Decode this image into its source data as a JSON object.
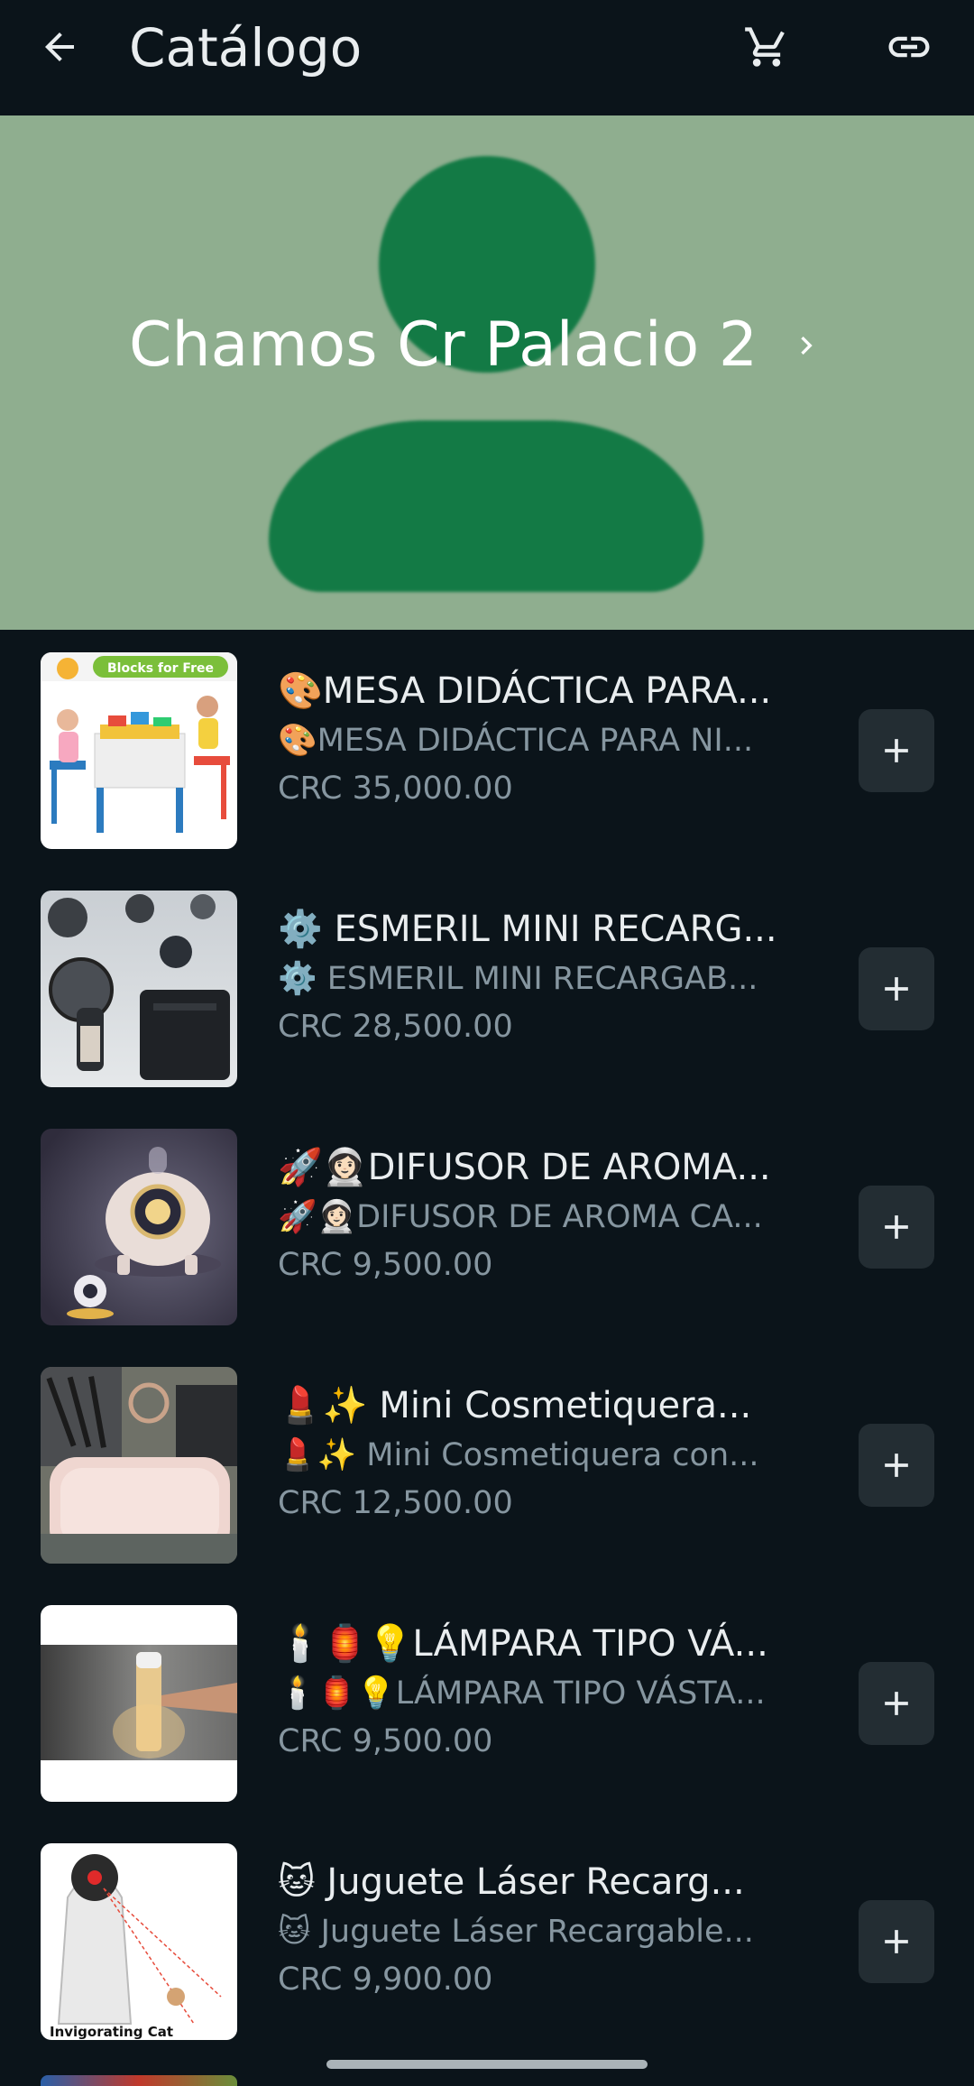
{
  "appbar": {
    "title": "Catálogo",
    "back_icon": "arrow-left-icon",
    "cart_icon": "cart-icon",
    "link_icon": "link-icon"
  },
  "banner": {
    "store_name": "Chamos Cr Palacio 2",
    "chevron_icon": "chevron-right-icon",
    "background": "#8fae8f",
    "avatar_color": "#137a45"
  },
  "products": [
    {
      "name": "🎨MESA DIDÁCTICA PARA...",
      "desc": "🎨MESA DIDÁCTICA PARA NI...",
      "price": "CRC 35,000.00",
      "thumb_label": "Blocks for Free"
    },
    {
      "name": "⚙️ ESMERIL MINI RECARG...",
      "desc": "⚙️ ESMERIL MINI RECARGAB...",
      "price": "CRC 28,500.00"
    },
    {
      "name": "🚀👩🏻‍🚀DIFUSOR DE AROMA...",
      "desc": "🚀👩🏻‍🚀DIFUSOR DE AROMA CA...",
      "price": "CRC 9,500.00"
    },
    {
      "name": "💄✨ Mini Cosmetiquera...",
      "desc": "💄✨ Mini Cosmetiquera con...",
      "price": "CRC 12,500.00"
    },
    {
      "name": "🕯️🏮💡LÁMPARA TIPO VÁ...",
      "desc": "🕯️🏮💡LÁMPARA TIPO VÁSTA...",
      "price": "CRC 9,500.00"
    },
    {
      "name": "🐱 Juguete Láser Recarg...",
      "desc": "🐱 Juguete Láser Recargable...",
      "price": "CRC 9,900.00",
      "thumb_label": "Invigorating Cat"
    }
  ],
  "colors": {
    "background": "#0b141a",
    "text_primary": "#e9edef",
    "text_secondary": "#8696a0",
    "add_button": "#232d33"
  }
}
